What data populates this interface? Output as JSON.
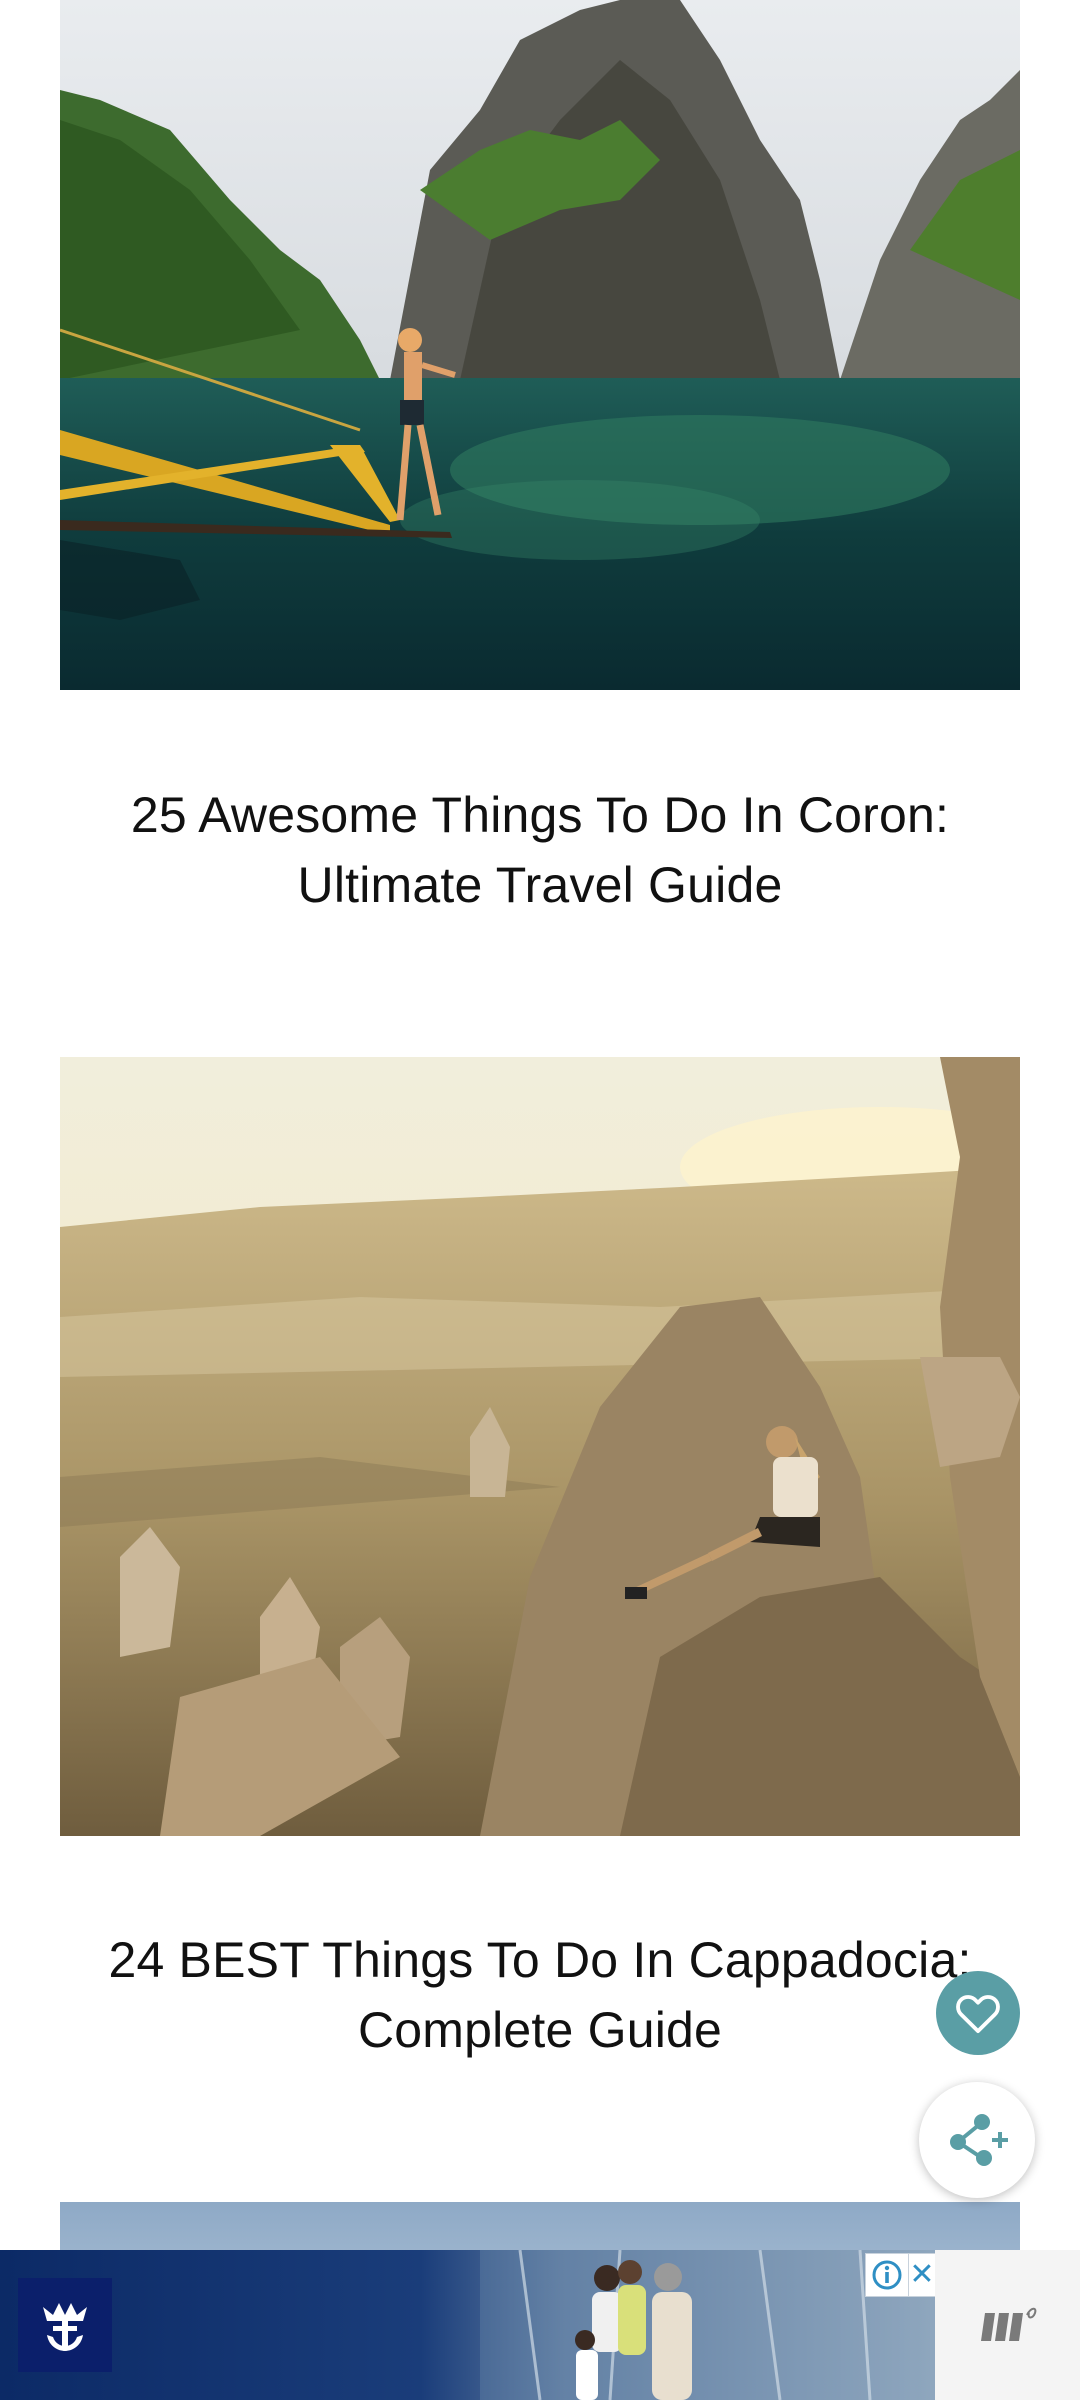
{
  "posts": [
    {
      "image_alt": "Man on boat outrigger in lagoon surrounded by limestone cliffs",
      "title_lines": [
        "25 Awesome Things To Do In Coron:",
        "Ultimate Travel Guide"
      ]
    },
    {
      "image_alt": "Man sitting on rock formation overlooking valley at sunset",
      "title_lines": [
        "24 BEST Things To Do In Cappadocia:",
        "Complete Guide"
      ]
    }
  ],
  "fab": {
    "heart_icon": "heart-icon",
    "share_icon": "share-plus-icon",
    "heart_color": "#5a9ea5"
  },
  "ad": {
    "logo_icon": "crown-anchor-logo",
    "info_icon": "info-icon",
    "close_label": "✕",
    "brand_color": "#0b1f6b"
  },
  "mediavine": {
    "logo_icon": "mediavine-logo"
  }
}
